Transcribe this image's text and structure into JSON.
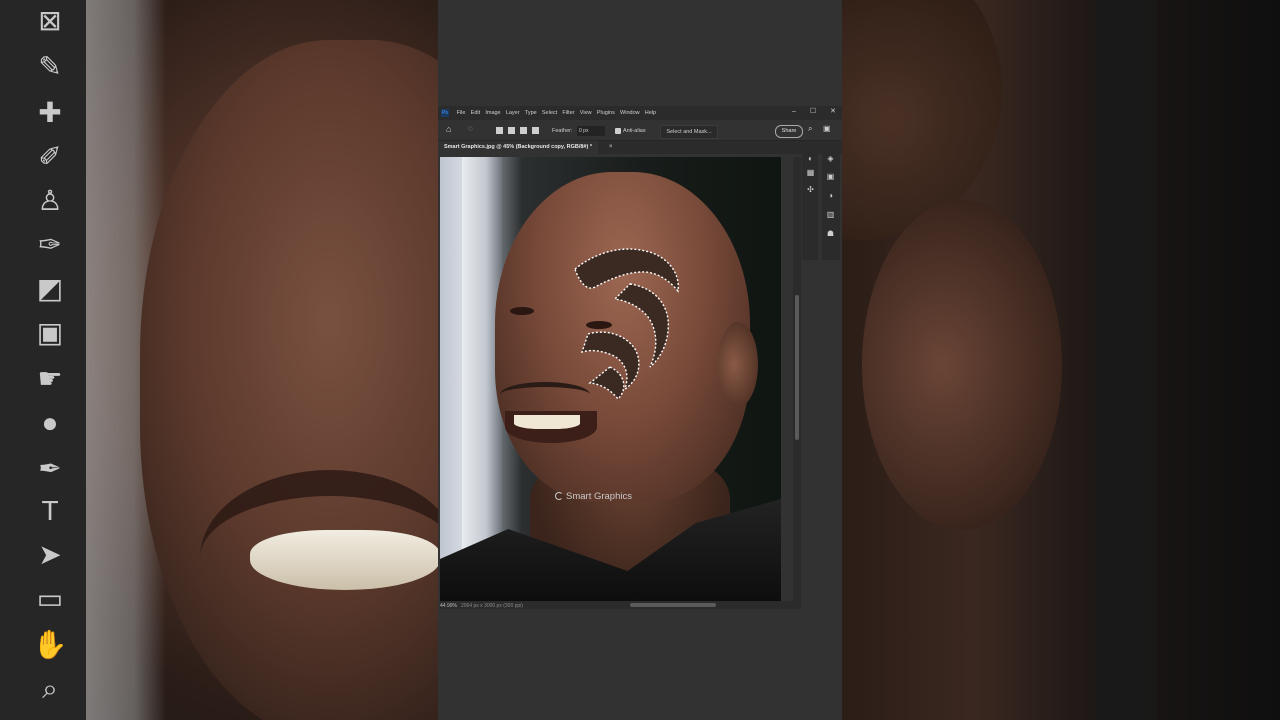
{
  "menubar": {
    "items": [
      "File",
      "Edit",
      "Image",
      "Layer",
      "Type",
      "Select",
      "Filter",
      "View",
      "Plugins",
      "Window",
      "Help"
    ],
    "win_minimize": "–",
    "win_maximize": "☐",
    "win_close": "✕"
  },
  "options": {
    "feather_label": "Feather:",
    "feather_value": "0 px",
    "antialias_label": "Anti-alias",
    "select_mask_label": "Select and Mask...",
    "share_label": "Share"
  },
  "document": {
    "tab_title": "Smart Graphics.jpg @ 45% (Background copy, RGB/8#) *",
    "close": "×",
    "watermark": "Smart Graphics"
  },
  "status": {
    "zoom": "44.99%",
    "dimensions": "2064 px x 3000 px (300 ppi)"
  }
}
